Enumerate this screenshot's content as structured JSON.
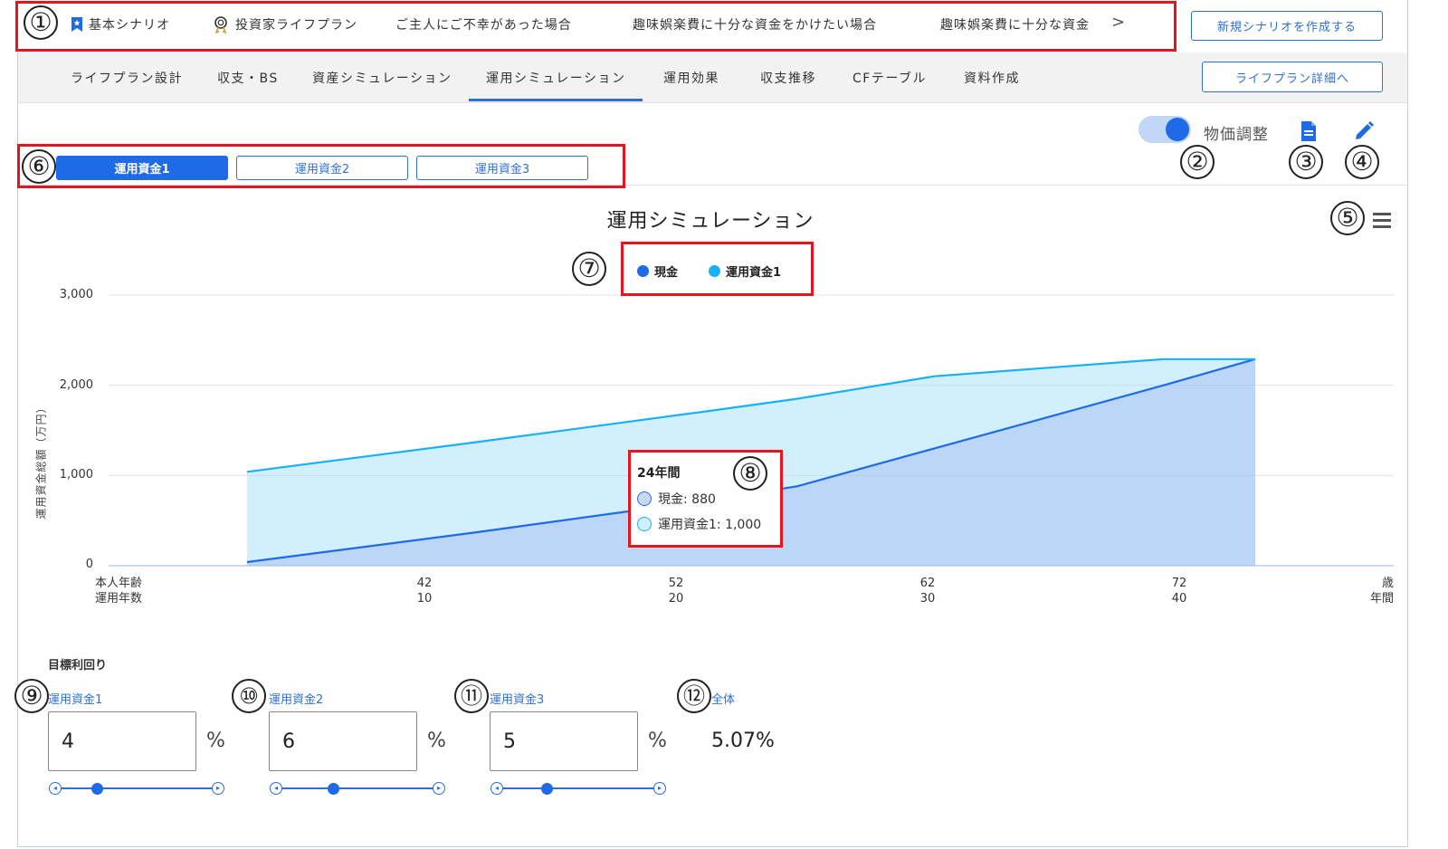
{
  "scenarios": {
    "items": [
      {
        "label": "基本シナリオ",
        "icon": "bookmark-star-icon"
      },
      {
        "label": "投資家ライフプラン",
        "icon": "medal-icon"
      },
      {
        "label": "ご主人にご不幸があった場合"
      },
      {
        "label": "趣味娯楽費に十分な資金をかけたい場合"
      },
      {
        "label": "趣味娯楽費に十分な資金"
      }
    ],
    "next_arrow": ">",
    "new_button": "新規シナリオを作成する"
  },
  "nav": {
    "tabs": [
      "ライフプラン設計",
      "収支・BS",
      "資産シミュレーション",
      "運用シミュレーション",
      "運用効果",
      "収支推移",
      "CFテーブル",
      "資料作成"
    ],
    "active": "運用シミュレーション",
    "detail_button": "ライフプラン詳細へ"
  },
  "toolbar": {
    "price_adjust_label": "物価調整",
    "price_adjust_on": true,
    "report_icon": "document-icon",
    "edit_icon": "pencil-icon"
  },
  "fund_tabs": [
    "運用資金1",
    "運用資金2",
    "運用資金3"
  ],
  "annotations": [
    "①",
    "②",
    "③",
    "④",
    "⑤",
    "⑥",
    "⑦",
    "⑧",
    "⑨",
    "⑩",
    "⑪",
    "⑫"
  ],
  "chart_data": {
    "type": "area",
    "title": "運用シミュレーション",
    "ylabel": "運用資金総額（万円）",
    "ylim": [
      0,
      3000
    ],
    "yticks": [
      "3,000",
      "2,000",
      "1,000",
      "0"
    ],
    "x_row_labels": [
      "本人年齢",
      "運用年数"
    ],
    "x_unit_labels": [
      "歳",
      "年間"
    ],
    "x_ticks": [
      {
        "age": "42",
        "years": "10"
      },
      {
        "age": "52",
        "years": "20"
      },
      {
        "age": "62",
        "years": "30"
      },
      {
        "age": "72",
        "years": "40"
      }
    ],
    "x": [
      0,
      10,
      20,
      24,
      30,
      40,
      44
    ],
    "series": [
      {
        "name": "現金",
        "color": "#1f6ae6",
        "values": [
          40,
          370,
          720,
          880,
          1300,
          2000,
          2290
        ]
      },
      {
        "name": "運用資金1",
        "color": "#19b1f5",
        "values": [
          1040,
          1370,
          1710,
          1850,
          2100,
          2290,
          2290
        ]
      }
    ],
    "tooltip": {
      "title": "24年間",
      "rows": [
        "現金: 880",
        "運用資金1: 1,000"
      ]
    }
  },
  "target_returns": {
    "title": "目標利回り",
    "funds": [
      {
        "label": "運用資金1",
        "value": "4",
        "unit": "%",
        "slider_fraction": 0.25
      },
      {
        "label": "運用資金2",
        "value": "6",
        "unit": "%",
        "slider_fraction": 0.35
      },
      {
        "label": "運用資金3",
        "value": "5",
        "unit": "%",
        "slider_fraction": 0.3
      }
    ],
    "overall": {
      "label": "全体",
      "value": "5.07%"
    }
  }
}
